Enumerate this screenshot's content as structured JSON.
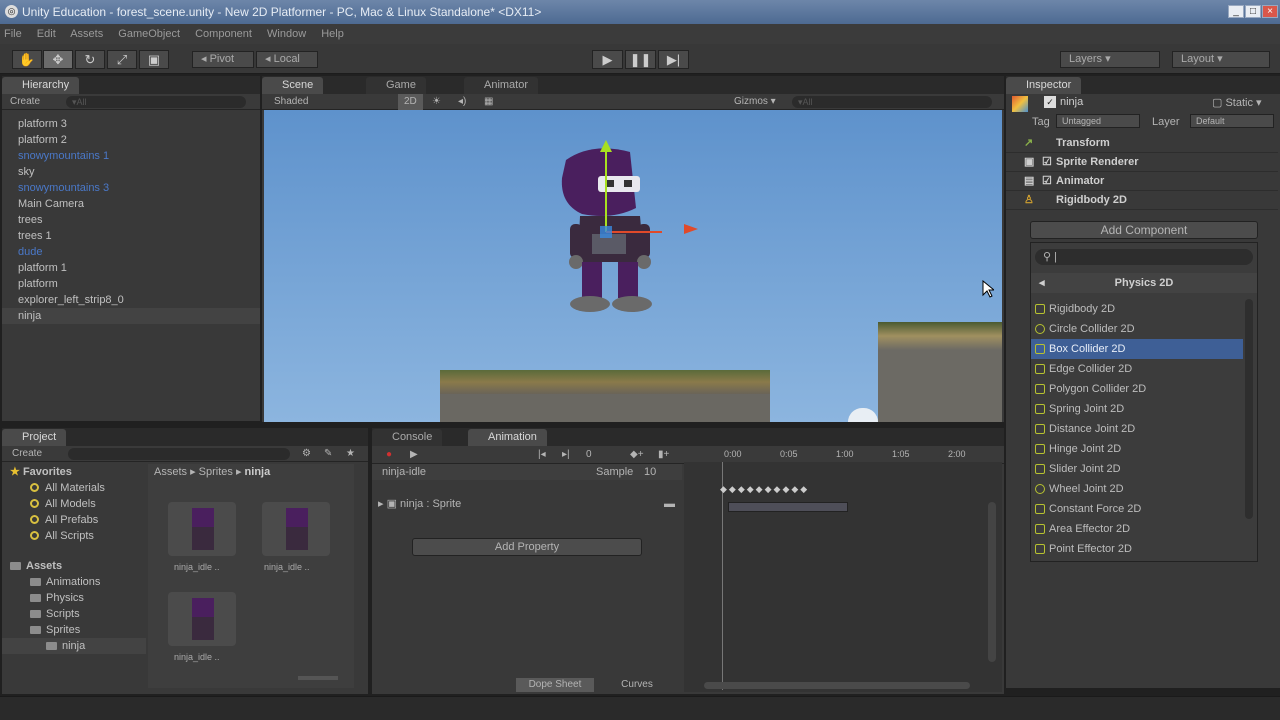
{
  "window": {
    "title": "Unity Education - forest_scene.unity - New 2D Platformer - PC, Mac & Linux Standalone* <DX11>"
  },
  "menu": [
    "File",
    "Edit",
    "Assets",
    "GameObject",
    "Component",
    "Window",
    "Help"
  ],
  "toolbar": {
    "pivot": "Pivot",
    "local": "Local",
    "layers": "Layers",
    "layout": "Layout"
  },
  "hierarchy": {
    "tab": "Hierarchy",
    "create": "Create",
    "search": "▾All",
    "items": [
      {
        "label": "platform 3",
        "style": "normal"
      },
      {
        "label": "platform 2",
        "style": "normal"
      },
      {
        "label": "snowymountains 1",
        "style": "blue"
      },
      {
        "label": "sky",
        "style": "normal"
      },
      {
        "label": "snowymountains 3",
        "style": "blue"
      },
      {
        "label": "Main Camera",
        "style": "normal"
      },
      {
        "label": "trees",
        "style": "normal"
      },
      {
        "label": "trees 1",
        "style": "normal"
      },
      {
        "label": "dude",
        "style": "blue"
      },
      {
        "label": "platform 1",
        "style": "normal"
      },
      {
        "label": "platform",
        "style": "normal"
      },
      {
        "label": "explorer_left_strip8_0",
        "style": "normal"
      },
      {
        "label": "ninja",
        "style": "selected"
      }
    ]
  },
  "scene": {
    "tabs": [
      "Scene",
      "Game",
      "Animator"
    ],
    "shaded": "Shaded",
    "mode2d": "2D",
    "gizmos": "Gizmos",
    "search": "▾All"
  },
  "inspector": {
    "tab": "Inspector",
    "object_name": "ninja",
    "static": "Static",
    "tag_label": "Tag",
    "tag_value": "Untagged",
    "layer_label": "Layer",
    "layer_value": "Default",
    "components": [
      "Transform",
      "Sprite Renderer",
      "Animator",
      "Rigidbody 2D"
    ],
    "add_component": "Add Component",
    "category": "Physics 2D",
    "options": [
      "Rigidbody 2D",
      "Circle Collider 2D",
      "Box Collider 2D",
      "Edge Collider 2D",
      "Polygon Collider 2D",
      "Spring Joint 2D",
      "Distance Joint 2D",
      "Hinge Joint 2D",
      "Slider Joint 2D",
      "Wheel Joint 2D",
      "Constant Force 2D",
      "Area Effector 2D",
      "Point Effector 2D"
    ],
    "selected_option": "Box Collider 2D"
  },
  "project": {
    "tab": "Project",
    "create": "Create",
    "favorites_label": "Favorites",
    "favorites": [
      "All Materials",
      "All Models",
      "All Prefabs",
      "All Scripts"
    ],
    "assets_label": "Assets",
    "folders": [
      "Animations",
      "Physics",
      "Scripts",
      "Sprites"
    ],
    "subfolder": "ninja",
    "breadcrumb": [
      "Assets",
      "Sprites",
      "ninja"
    ],
    "files": [
      "ninja_idle ..",
      "ninja_idle ..",
      "ninja_idle .."
    ]
  },
  "animation": {
    "tabs": [
      "Console",
      "Animation"
    ],
    "frame": "0",
    "clip": "ninja-idle",
    "sample_label": "Sample",
    "sample_value": "10",
    "property": "ninja : Sprite",
    "add_property": "Add Property",
    "times": [
      "0:00",
      "0:05",
      "1:00",
      "1:05",
      "2:00"
    ],
    "dope_sheet": "Dope Sheet",
    "curves": "Curves"
  },
  "colors": {
    "selection": "#3e5f96",
    "sky": "#6e9fd2",
    "ninja_purple": "#4a1f5e"
  }
}
